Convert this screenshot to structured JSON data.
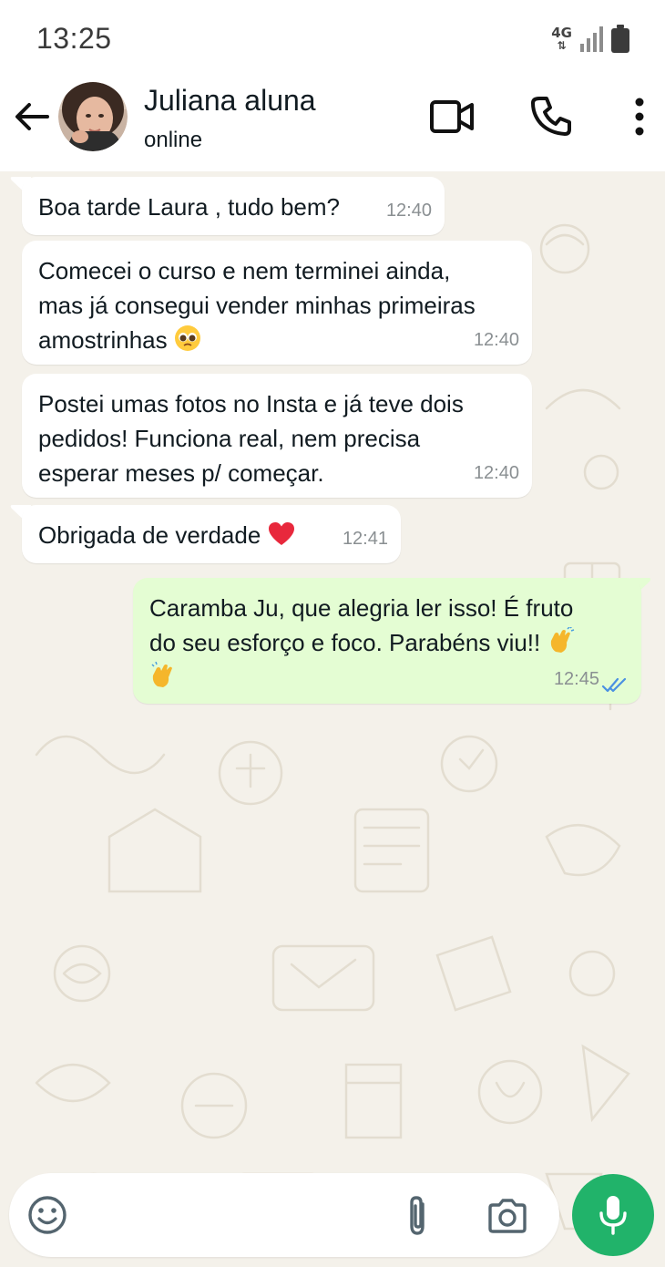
{
  "status_bar": {
    "time": "13:25",
    "network": "4G",
    "icons": [
      "signal-icon",
      "battery-icon"
    ]
  },
  "header": {
    "contact_name": "Juliana aluna",
    "contact_status": "online",
    "icons": [
      "back-arrow-icon",
      "video-call-icon",
      "phone-icon",
      "more-vert-icon"
    ]
  },
  "messages": [
    {
      "direction": "in",
      "text": "Boa tarde Laura , tudo bem?",
      "time": "12:40"
    },
    {
      "direction": "in",
      "text": "Comecei o curso e nem terminei ainda,\nmas já consegui vender minhas primeiras\namostrinhas",
      "emoji": "pleading-face",
      "time": "12:40"
    },
    {
      "direction": "in",
      "text": "Postei umas fotos no Insta e já teve dois\npedidos! Funciona real, nem precisa\nesperar meses p/ começar.",
      "time": "12:40"
    },
    {
      "direction": "in",
      "text": "Obrigada de verdade",
      "emoji": "red-heart",
      "time": "12:41"
    },
    {
      "direction": "out",
      "text": "Caramba Ju, que alegria ler isso! É fruto\ndo seu esforço e foco. Parabéns viu!!",
      "emoji": "clapping-hands",
      "time": "12:45",
      "read": true
    }
  ],
  "composer": {
    "icons": [
      "emoji-icon",
      "attach-icon",
      "camera-icon",
      "mic-icon"
    ],
    "input_value": ""
  },
  "colors": {
    "chat_background": "#f4f1ea",
    "incoming_bubble": "#ffffff",
    "outgoing_bubble": "#e4fdd3",
    "read_ticks": "#4a90e2",
    "mic_button": "#21b36a"
  }
}
